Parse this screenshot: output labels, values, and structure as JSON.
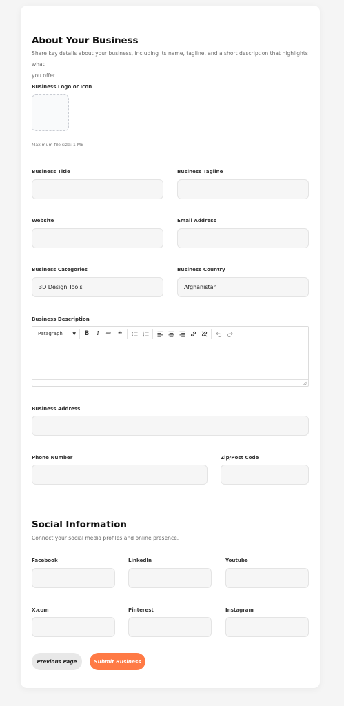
{
  "business": {
    "title": "About Your Business",
    "description_line1": "Share key details about your business, including its name, tagline, and a short description that highlights what",
    "description_line2": "you offer.",
    "logo_label": "Business Logo or Icon",
    "logo_hint": "Maximum file size: 1 MB",
    "fields": {
      "business_title": {
        "label": "Business Title",
        "value": ""
      },
      "business_tagline": {
        "label": "Business Tagline",
        "value": ""
      },
      "website": {
        "label": "Website",
        "value": ""
      },
      "email": {
        "label": "Email Address",
        "value": ""
      },
      "categories": {
        "label": "Business Categories",
        "value": "3D Design Tools"
      },
      "country": {
        "label": "Business Country",
        "value": "Afghanistan"
      },
      "description": {
        "label": "Business Description",
        "value": ""
      },
      "address": {
        "label": "Business Address",
        "value": ""
      },
      "phone": {
        "label": "Phone Number",
        "value": ""
      },
      "zip": {
        "label": "Zip/Post Code",
        "value": ""
      }
    },
    "editor": {
      "format_select": "Paragraph",
      "strikethrough_label": "ABC"
    }
  },
  "social": {
    "title": "Social Information",
    "description": "Connect your social media profiles and online presence.",
    "fields": {
      "facebook": {
        "label": "Facebook",
        "value": ""
      },
      "linkedin": {
        "label": "LinkedIn",
        "value": ""
      },
      "youtube": {
        "label": "Youtube",
        "value": ""
      },
      "xcom": {
        "label": "X.com",
        "value": ""
      },
      "pinterest": {
        "label": "Pinterest",
        "value": ""
      },
      "instagram": {
        "label": "Instagram",
        "value": ""
      }
    }
  },
  "actions": {
    "previous": "Previous Page",
    "submit": "Submit Business"
  },
  "colors": {
    "accent": "#ff7a45",
    "background": "#f5f5f5",
    "card": "#ffffff",
    "input_bg": "#f6f6f6"
  }
}
